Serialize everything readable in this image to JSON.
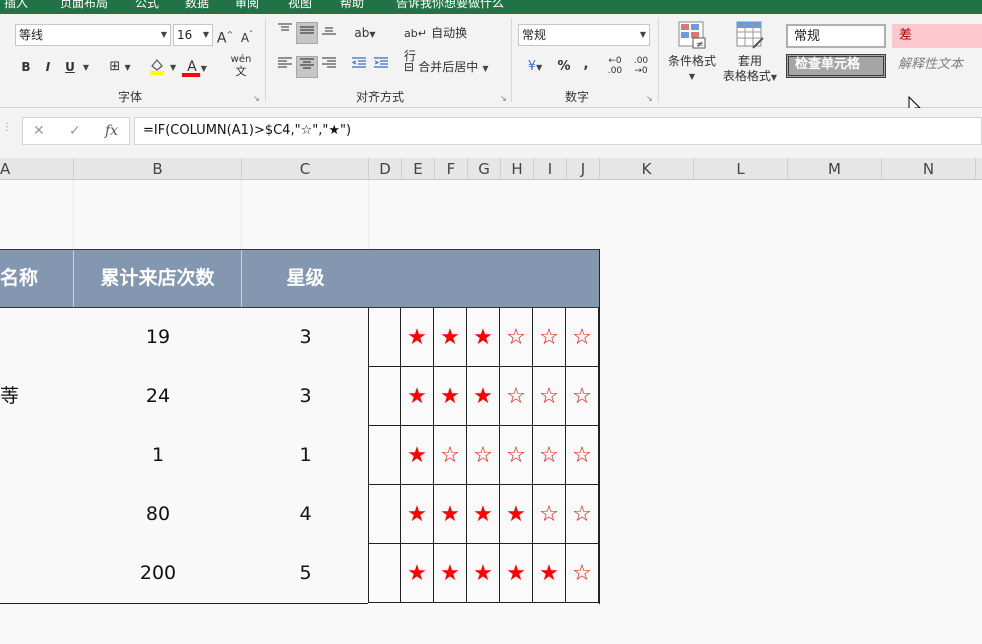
{
  "ribbon_top": {
    "tabs": [
      "插入",
      "页面布局",
      "公式",
      "数据",
      "审阅",
      "视图",
      "帮助",
      "告诉我你想要做什么"
    ]
  },
  "font": {
    "name": "等线",
    "size": "16",
    "grow_label": "A",
    "shrink_label": "A",
    "bold_label": "B",
    "italic_label": "I",
    "underline_label": "U",
    "fill_color": "#ffff00",
    "font_color": "#ff0000",
    "font_color_label": "A",
    "wen_label": "wén",
    "group_label": "字体"
  },
  "alignment": {
    "wrap_label": "自动换行",
    "merge_label": "合并后居中",
    "group_label": "对齐方式"
  },
  "number": {
    "format": "常规",
    "percent_label": "%",
    "comma_label": ",",
    "group_label": "数字"
  },
  "styles": {
    "conditional_label": "条件格式",
    "table_label_1": "套用",
    "table_label_2": "表格格式",
    "normal": "常规",
    "bad": "差",
    "check_cell": "检查单元格",
    "explanatory": "解释性文本"
  },
  "formula_bar": {
    "cancel": "✕",
    "enter": "✓",
    "fx": "fx",
    "formula": "=IF(COLUMN(A1)>$C4,\"☆\",\"★\")"
  },
  "columns": [
    "A",
    "B",
    "C",
    "D",
    "E",
    "F",
    "G",
    "H",
    "I",
    "J",
    "K",
    "L",
    "M",
    "N"
  ],
  "table": {
    "headers": [
      "名称",
      "累计来店次数",
      "星级"
    ],
    "rows": [
      {
        "name": "",
        "visits": "19",
        "level": "3",
        "stars": [
          "★",
          "★",
          "★",
          "☆",
          "☆",
          "☆"
        ]
      },
      {
        "name": "䓁",
        "visits": "24",
        "level": "3",
        "stars": [
          "★",
          "★",
          "★",
          "☆",
          "☆",
          "☆"
        ]
      },
      {
        "name": "",
        "visits": "1",
        "level": "1",
        "stars": [
          "★",
          "☆",
          "☆",
          "☆",
          "☆",
          "☆"
        ]
      },
      {
        "name": "",
        "visits": "80",
        "level": "4",
        "stars": [
          "★",
          "★",
          "★",
          "★",
          "☆",
          "☆"
        ]
      },
      {
        "name": "",
        "visits": "200",
        "level": "5",
        "stars": [
          "★",
          "★",
          "★",
          "★",
          "★",
          "☆"
        ]
      }
    ]
  },
  "colors": {
    "header_bg": "#8497b0",
    "star_red": "#ff0000",
    "excel_green": "#217346"
  }
}
